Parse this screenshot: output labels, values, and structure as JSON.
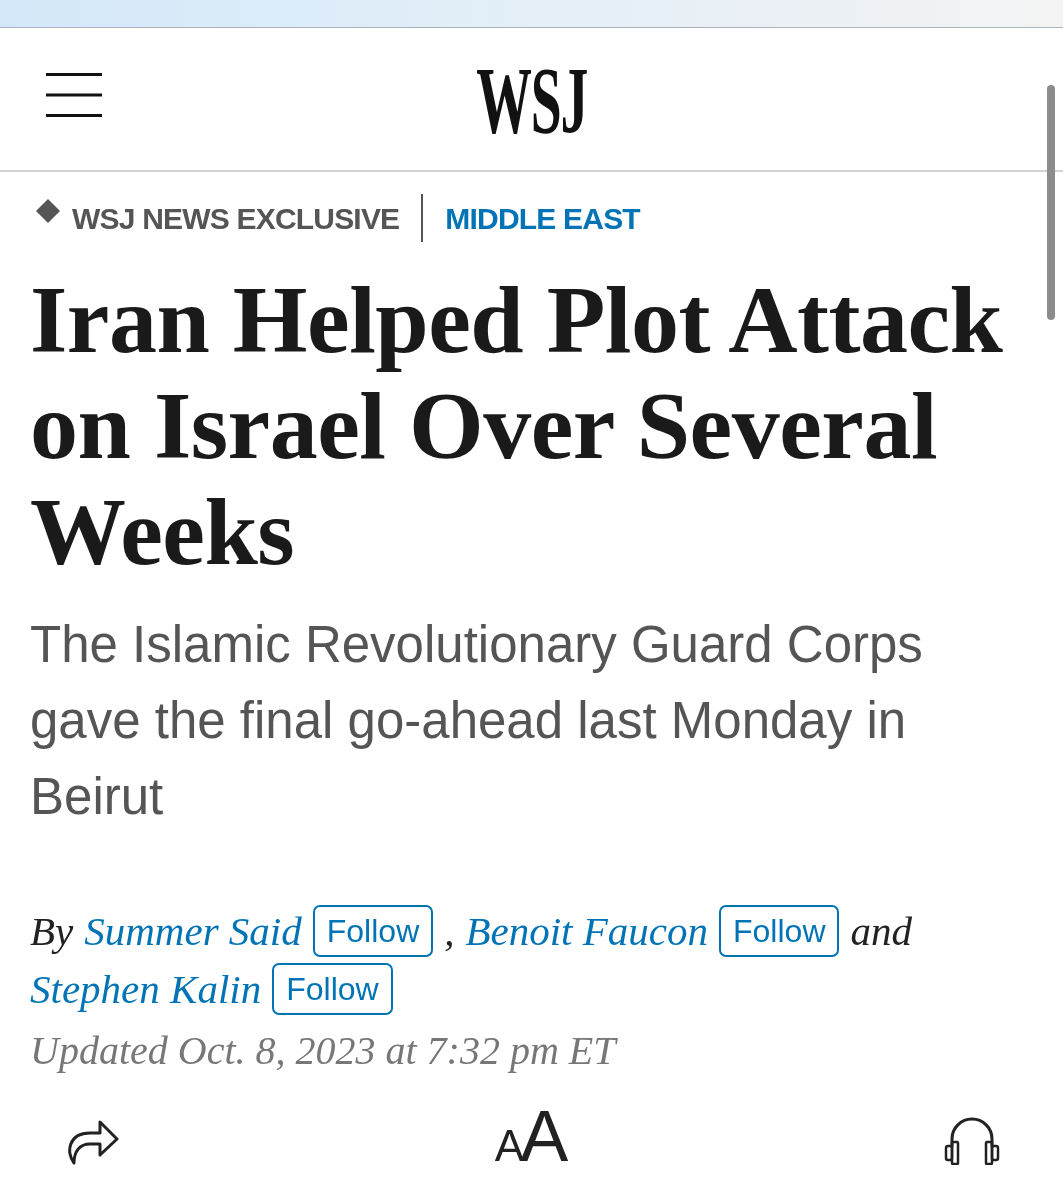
{
  "header": {
    "logo": "WSJ"
  },
  "kicker": {
    "label": "WSJ NEWS EXCLUSIVE",
    "section": "MIDDLE EAST"
  },
  "headline": "Iran Helped Plot Attack on Israel Over Several Weeks",
  "dek": "The Islamic Revolutionary Guard Corps gave the final go-ahead last Monday in Beirut",
  "byline": [
    {
      "kind": "text",
      "text": "By"
    },
    {
      "kind": "author",
      "name": "Summer Said",
      "follow": "Follow"
    },
    {
      "kind": "text",
      "text": ","
    },
    {
      "kind": "author",
      "name": "Benoit Faucon",
      "follow": "Follow"
    },
    {
      "kind": "text",
      "text": "and"
    },
    {
      "kind": "author",
      "name": "Stephen Kalin",
      "follow": "Follow"
    }
  ],
  "timestamp": "Updated Oct. 8, 2023 at 7:32 pm ET",
  "toolbar": [
    {
      "kind": "share"
    },
    {
      "kind": "text_size",
      "small": "A",
      "large": "A"
    },
    {
      "kind": "listen"
    }
  ]
}
